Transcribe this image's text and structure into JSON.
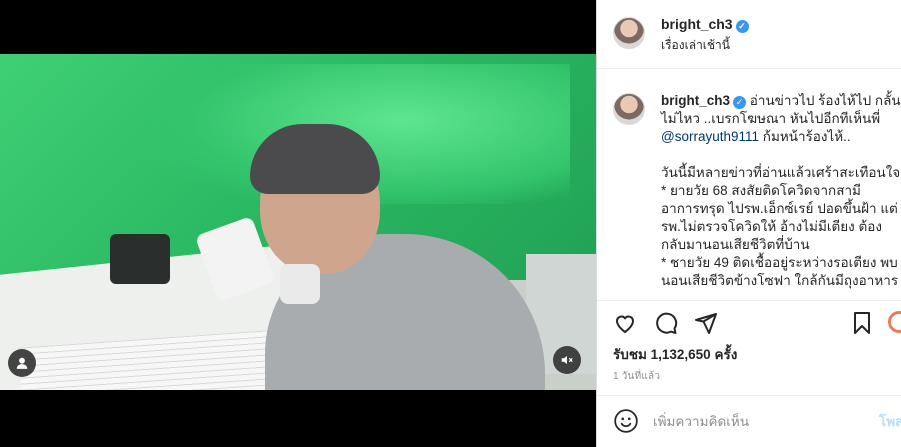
{
  "post": {
    "username": "bright_ch3",
    "location": "เรื่องเล่าเช้านี้",
    "caption_username": "bright_ch3",
    "caption_text_1": " อ่านข่าวไป ร้องไห้ไป กลั้นไม่ไหว ..เบรกโฆษณา หันไปอีกทีเห็นพี่ ",
    "caption_mention": "@sorrayuth9111",
    "caption_text_2": " ก้มหน้าร้องไห้..\n\nวันนี้มีหลายข่าวที่อ่านแล้วเศร้าสะเทือนใจ\n* ยายวัย 68 สงสัยติดโควิดจากสามี อาการทรุด ไปรพ.เอ็กซ์เรย์ ปอดขึ้นฝ้า แต่รพ.ไม่ตรวจโควิดให้ อ้างไม่มีเตียง ต้องกลับมานอนเสียชีวิตที่บ้าน\n* ชายวัย 49 ติดเชื้ออยู่ระหว่างรอเตียง พบนอนเสียชีวิตข้างโซฟา ใกล้กันมีถุงอาหาร",
    "likes": "รับชม 1,132,650 ครั้ง",
    "time_ago": "1 วันที่แล้ว",
    "comment_placeholder": "เพิ่มความคิดเห็น",
    "post_button": "โพสต์"
  },
  "icons": {
    "verified": "verified-badge-icon",
    "like": "heart-icon",
    "comment": "comment-icon",
    "share": "send-icon",
    "save": "bookmark-icon",
    "emoji": "emoji-icon",
    "mute": "muted-speaker-icon",
    "tagged": "user-icon"
  },
  "colors": {
    "verified": "#3897f0",
    "mention": "#00376b",
    "post_button": "#b2dffc"
  }
}
